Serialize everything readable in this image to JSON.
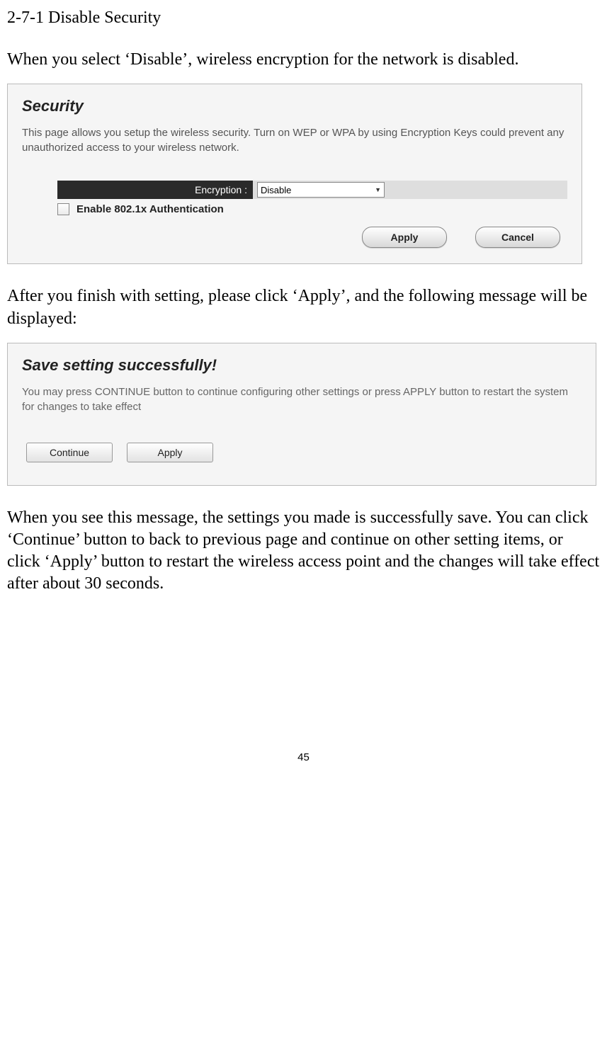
{
  "heading": "2-7-1 Disable Security",
  "para1": "When you select ‘Disable’, wireless encryption for the network is disabled.",
  "screenshot1": {
    "title": "Security",
    "description": "This page allows you setup the wireless security. Turn on WEP or WPA by using Encryption Keys could prevent any unauthorized access to your wireless network.",
    "encryption_label": "Encryption :",
    "encryption_value": "Disable",
    "checkbox_label": "Enable 802.1x Authentication",
    "apply_label": "Apply",
    "cancel_label": "Cancel"
  },
  "para2": "After you finish with setting, please click ‘Apply’, and the following message will be displayed:",
  "screenshot2": {
    "title": "Save setting successfully!",
    "description": "You may press CONTINUE button to continue configuring other settings or press APPLY button to restart the system for changes to take effect",
    "continue_label": "Continue",
    "apply_label": "Apply"
  },
  "para3": "When you see this message, the settings you made is successfully save. You can click ‘Continue’ button to back to previous page and continue on other setting items, or click ‘Apply’ button to restart the wireless access point and the changes will take effect after about 30 seconds.",
  "page_number": "45"
}
